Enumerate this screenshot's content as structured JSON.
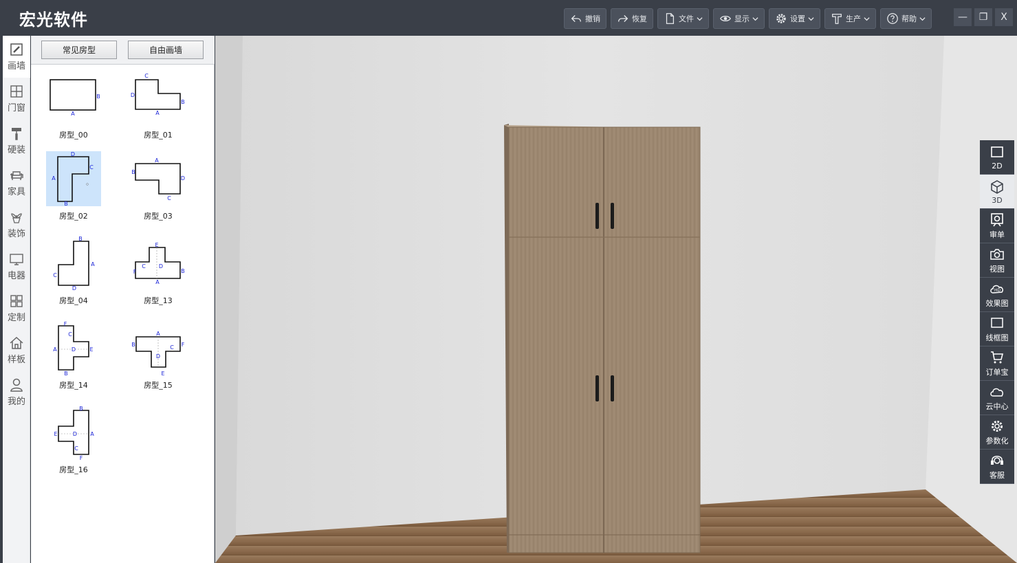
{
  "app": {
    "title": "宏光软件"
  },
  "toolbar": {
    "undo": "撤销",
    "redo": "恢复",
    "file": "文件",
    "display": "显示",
    "settings": "设置",
    "produce": "生产",
    "help": "帮助"
  },
  "window": {
    "min": "—",
    "max": "❐",
    "close": "X"
  },
  "rail": [
    {
      "label": "画墙",
      "icon": "pencil-icon"
    },
    {
      "label": "门窗",
      "icon": "window-icon"
    },
    {
      "label": "硬装",
      "icon": "paint-roller-icon"
    },
    {
      "label": "家具",
      "icon": "sofa-icon"
    },
    {
      "label": "装饰",
      "icon": "plant-icon"
    },
    {
      "label": "电器",
      "icon": "monitor-icon"
    },
    {
      "label": "定制",
      "icon": "grid-icon"
    },
    {
      "label": "样板",
      "icon": "house-icon"
    },
    {
      "label": "我的",
      "icon": "user-icon"
    }
  ],
  "panel": {
    "tab_common": "常见房型",
    "tab_free": "自由画墙",
    "shapes": [
      {
        "label": "房型_00"
      },
      {
        "label": "房型_01"
      },
      {
        "label": "房型_02",
        "selected": true
      },
      {
        "label": "房型_03"
      },
      {
        "label": "房型_04"
      },
      {
        "label": "房型_13"
      },
      {
        "label": "房型_14"
      },
      {
        "label": "房型_15"
      },
      {
        "label": "房型_16"
      }
    ]
  },
  "right_tools": [
    {
      "label": "2D",
      "icon": "square-2d-icon"
    },
    {
      "label": "3D",
      "icon": "cube-3d-icon",
      "active": true
    },
    {
      "label": "审单",
      "icon": "review-icon"
    },
    {
      "label": "视图",
      "icon": "camera-icon"
    },
    {
      "label": "效果图",
      "icon": "hd-cloud-icon"
    },
    {
      "label": "线框图",
      "icon": "wireframe-icon"
    },
    {
      "label": "订单宝",
      "icon": "cart-icon"
    },
    {
      "label": "云中心",
      "icon": "cloud-icon"
    },
    {
      "label": "参数化",
      "icon": "gear-icon"
    },
    {
      "label": "客服",
      "icon": "headset-icon"
    }
  ],
  "colors": {
    "titlebar": "#3a3f48",
    "wall": "#e2e2e2",
    "floor": "#8a6a4d",
    "wardrobe": "#9c8670",
    "selection": "#cde4fb",
    "shape_labels": "#1a23d6"
  }
}
